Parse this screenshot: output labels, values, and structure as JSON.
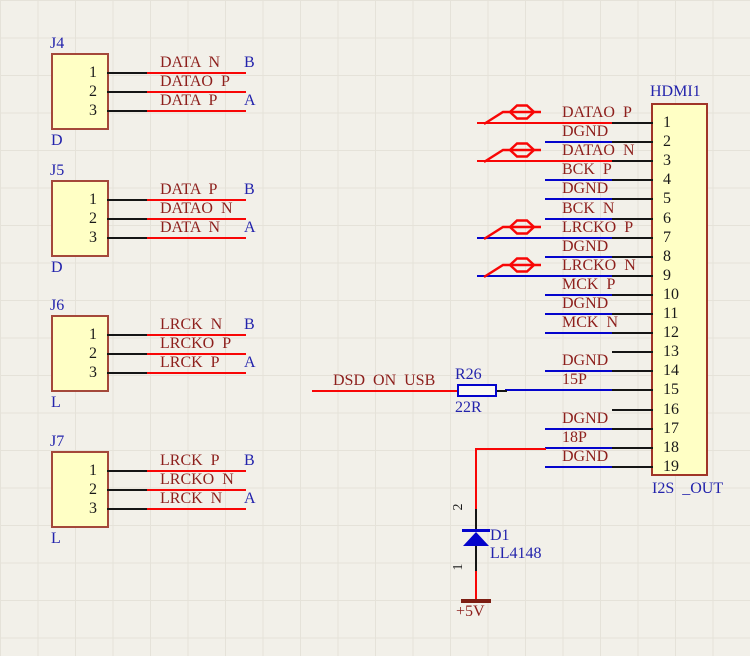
{
  "colors": {
    "wire_red": "#F80606",
    "wire_blue": "#0404CC",
    "net_text": "#8D1F1C",
    "designator_text": "#2323AC",
    "component_fill": "#FFFFC5",
    "component_border": "#A4483A",
    "background": "#F2F0E9"
  },
  "connectors": [
    {
      "designator": "J4",
      "part_label": "D",
      "pins": [
        {
          "num": "1",
          "net": "DATA N",
          "port": "B"
        },
        {
          "num": "2",
          "net": "DATAO P",
          "port": ""
        },
        {
          "num": "3",
          "net": "DATA P",
          "port": "A"
        }
      ]
    },
    {
      "designator": "J5",
      "part_label": "D",
      "pins": [
        {
          "num": "1",
          "net": "DATA P",
          "port": "B"
        },
        {
          "num": "2",
          "net": "DATAO N",
          "port": ""
        },
        {
          "num": "3",
          "net": "DATA N",
          "port": "A"
        }
      ]
    },
    {
      "designator": "J6",
      "part_label": "L",
      "pins": [
        {
          "num": "1",
          "net": "LRCK N",
          "port": "B"
        },
        {
          "num": "2",
          "net": "LRCKO P",
          "port": ""
        },
        {
          "num": "3",
          "net": "LRCK P",
          "port": "A"
        }
      ]
    },
    {
      "designator": "J7",
      "part_label": "L",
      "pins": [
        {
          "num": "1",
          "net": "LRCK P",
          "port": "B"
        },
        {
          "num": "2",
          "net": "LRCKO N",
          "port": ""
        },
        {
          "num": "3",
          "net": "LRCK N",
          "port": "A"
        }
      ]
    }
  ],
  "hdmi": {
    "designator": "HDMI1",
    "footer": "I2S _OUT",
    "pins": [
      {
        "num": "1",
        "net": "DATAO P",
        "wire": "red",
        "reach": "bead",
        "bead": true
      },
      {
        "num": "2",
        "net": "DGND",
        "wire": "blue",
        "reach": "short",
        "bead": false
      },
      {
        "num": "3",
        "net": "DATAO N",
        "wire": "red",
        "reach": "bead",
        "bead": true
      },
      {
        "num": "4",
        "net": "BCK P",
        "wire": "blue",
        "reach": "short",
        "bead": false
      },
      {
        "num": "5",
        "net": "DGND",
        "wire": "blue",
        "reach": "short",
        "bead": false
      },
      {
        "num": "6",
        "net": "BCK N",
        "wire": "blue",
        "reach": "short",
        "bead": false
      },
      {
        "num": "7",
        "net": "LRCKO P",
        "wire": "blue",
        "reach": "bead",
        "bead": true
      },
      {
        "num": "8",
        "net": "DGND",
        "wire": "blue",
        "reach": "short",
        "bead": false
      },
      {
        "num": "9",
        "net": "LRCKO N",
        "wire": "blue",
        "reach": "bead",
        "bead": true
      },
      {
        "num": "10",
        "net": "MCK P",
        "wire": "blue",
        "reach": "short",
        "bead": false
      },
      {
        "num": "11",
        "net": "DGND",
        "wire": "blue",
        "reach": "short",
        "bead": false
      },
      {
        "num": "12",
        "net": "MCK N",
        "wire": "blue",
        "reach": "short",
        "bead": false
      },
      {
        "num": "13",
        "net": "",
        "wire": null,
        "reach": null,
        "bead": false
      },
      {
        "num": "14",
        "net": "DGND",
        "wire": "blue",
        "reach": "short",
        "bead": false
      },
      {
        "num": "15",
        "net": "15P",
        "wire": "blue",
        "reach": "r26",
        "bead": false
      },
      {
        "num": "16",
        "net": "",
        "wire": null,
        "reach": null,
        "bead": false
      },
      {
        "num": "17",
        "net": "DGND",
        "wire": "blue",
        "reach": "short",
        "bead": false
      },
      {
        "num": "18",
        "net": "18P",
        "wire": "blue",
        "reach": "short",
        "bead": false
      },
      {
        "num": "19",
        "net": "DGND",
        "wire": "blue",
        "reach": "short",
        "bead": false
      }
    ]
  },
  "resistor": {
    "designator": "R26",
    "value": "22R",
    "input_net": "DSD ON USB"
  },
  "diode": {
    "designator": "D1",
    "value": "LL4148",
    "pin_top": "2",
    "pin_bottom": "1"
  },
  "power": {
    "label": "+5V"
  }
}
